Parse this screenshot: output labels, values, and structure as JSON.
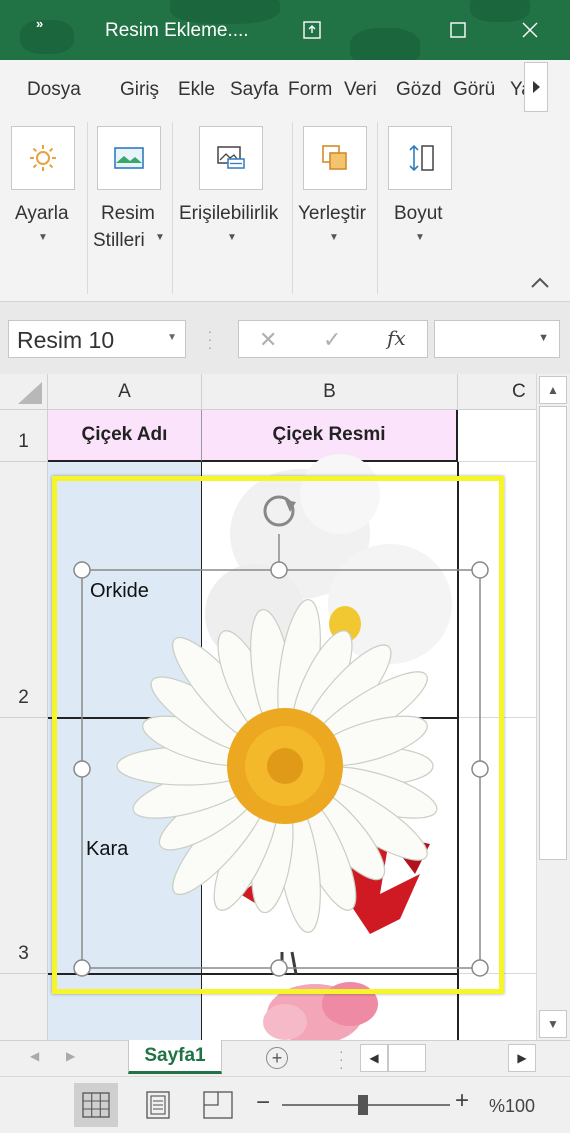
{
  "window": {
    "title": "Resim Ekleme....",
    "brand_color": "#217346"
  },
  "tabs": [
    "Dosya",
    "Giriş",
    "Ekle",
    "Sayfa",
    "Form",
    "Veri",
    "Gözd",
    "Görü",
    "Ya"
  ],
  "ribbon": {
    "groups": [
      {
        "label": "Ayarla",
        "icon": "sun-adjust-icon"
      },
      {
        "label_line1": "Resim",
        "label_line2": "Stilleri",
        "icon": "picture-styles-icon"
      },
      {
        "label": "Erişilebilirlik",
        "icon": "alt-text-icon"
      },
      {
        "label": "Yerleştir",
        "icon": "arrange-icon"
      },
      {
        "label": "Boyut",
        "icon": "size-icon"
      }
    ]
  },
  "formula_bar": {
    "name_box": "Resim 10",
    "fx": "fx",
    "formula_value": ""
  },
  "sheet": {
    "columns": [
      "A",
      "B",
      "C"
    ],
    "rows": [
      "1",
      "2",
      "3"
    ],
    "header_a": "Çiçek Adı",
    "header_b": "Çiçek Resmi",
    "a2_top": "Orkide",
    "a2_bottom": "Kara",
    "header_fill": "#fbe4fb",
    "column_a_fill": "#dde9f5"
  },
  "selection": {
    "border_color": "#f5f52a"
  },
  "sheet_tabs": {
    "active": "Sayfa1"
  },
  "status": {
    "zoom": "%100",
    "zoom_percent": 100
  }
}
